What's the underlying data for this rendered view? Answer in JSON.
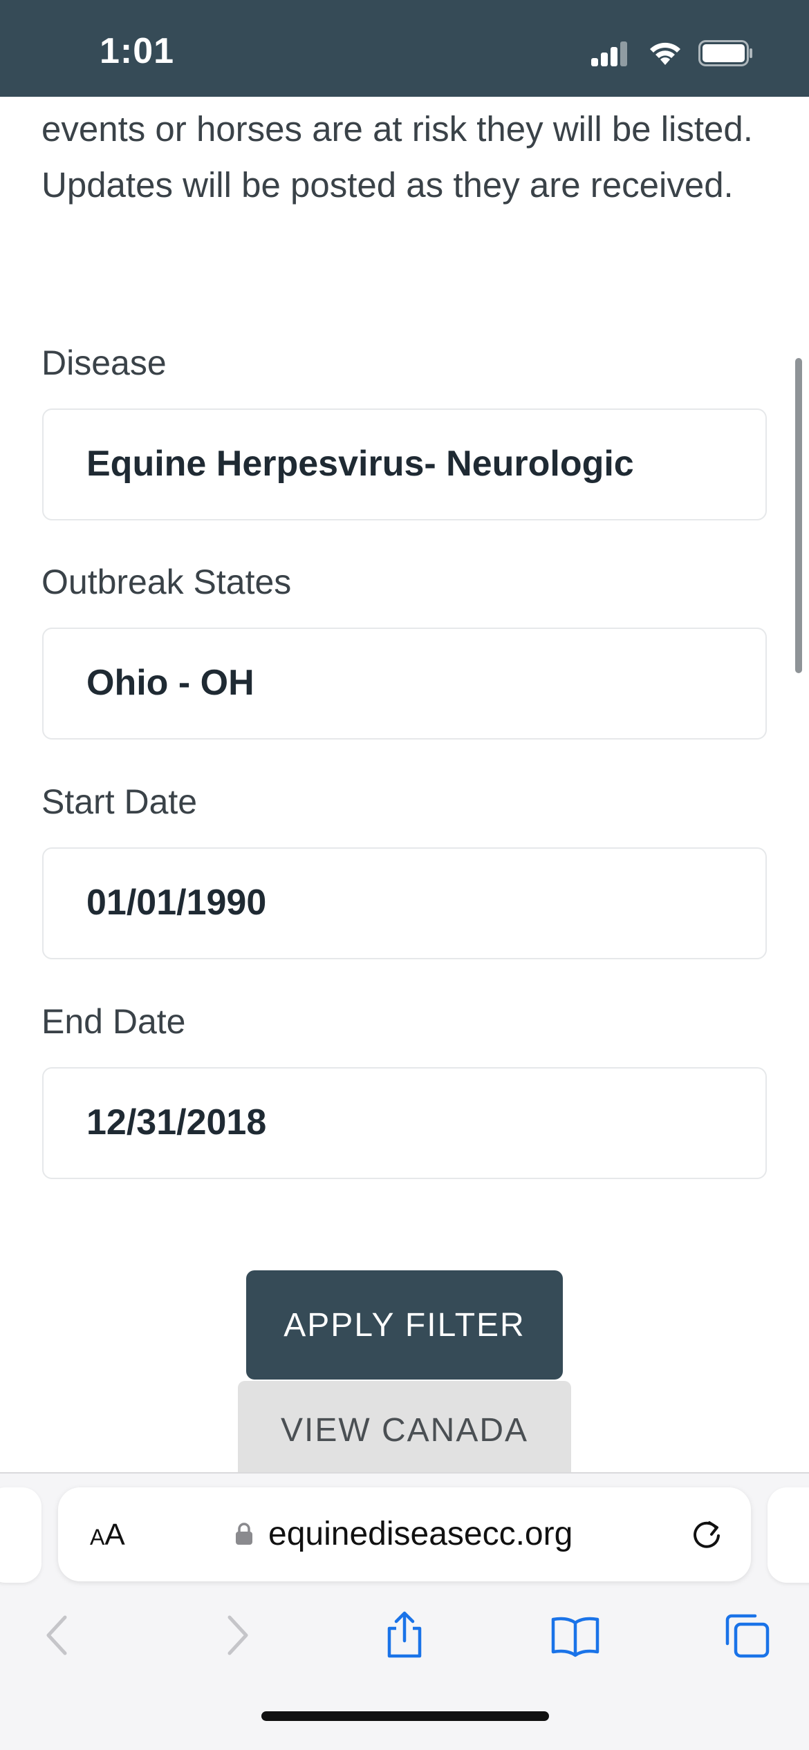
{
  "status_bar": {
    "time": "1:01"
  },
  "intro_text": "events or horses are at risk they will be listed. Updates will be posted as they are received.",
  "filters": {
    "disease": {
      "label": "Disease",
      "value": "Equine Herpesvirus- Neurologic"
    },
    "outbreak_states": {
      "label": "Outbreak States",
      "value": "Ohio - OH"
    },
    "start_date": {
      "label": "Start Date",
      "value": "01/01/1990"
    },
    "end_date": {
      "label": "End Date",
      "value": "12/31/2018"
    }
  },
  "buttons": {
    "apply_filter": "APPLY FILTER",
    "view_canada": "VIEW CANADA"
  },
  "browser": {
    "text_size_label_small": "A",
    "text_size_label_large": "A",
    "url": "equinediseasecc.org"
  },
  "colors": {
    "header": "#364b57",
    "primary_button": "#364b57",
    "secondary_button": "#e1e1e1",
    "browser_accent": "#1a73e8"
  },
  "icons": {
    "signal": "cellular-signal-icon",
    "wifi": "wifi-icon",
    "battery": "battery-icon",
    "lock": "lock-icon",
    "reload": "reload-icon",
    "back": "chevron-left-icon",
    "forward": "chevron-right-icon",
    "share": "share-icon",
    "bookmarks": "bookmarks-icon",
    "tabs": "tabs-icon"
  }
}
